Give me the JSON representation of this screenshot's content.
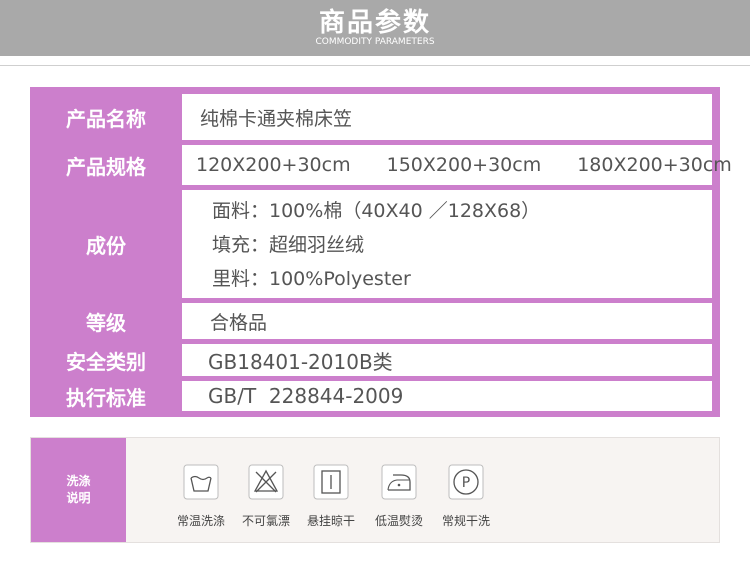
{
  "header": {
    "title": "商品参数",
    "subtitle": "COMMODITY PARAMETERS"
  },
  "params": {
    "name": {
      "label": "产品名称",
      "value": "纯棉卡通夹棉床笠"
    },
    "spec": {
      "label": "产品规格",
      "values": [
        "120X200+30cm",
        "150X200+30cm",
        "180X200+30cm"
      ]
    },
    "composition": {
      "label": "成份",
      "lines": [
        "面料：100%棉（40X40 ／128X68）",
        "填充：超细羽丝绒",
        "里料：100%Polyester"
      ]
    },
    "grade": {
      "label": "等级",
      "value": "合格品"
    },
    "safety": {
      "label": "安全类别",
      "value": "GB18401-2010B类"
    },
    "standard": {
      "label": "执行标准",
      "value": "GB/T  228844-2009"
    }
  },
  "care": {
    "label_line1": "洗涤",
    "label_line2": "说明",
    "items": [
      {
        "icon": "wash-tub-icon",
        "text": "常温洗涤"
      },
      {
        "icon": "no-bleach-icon",
        "text": "不可氯漂"
      },
      {
        "icon": "hang-dry-icon",
        "text": "悬挂晾干"
      },
      {
        "icon": "low-iron-icon",
        "text": "低温熨烫"
      },
      {
        "icon": "dry-clean-p-icon",
        "text": "常规干洗"
      }
    ]
  },
  "colors": {
    "accent": "#cc7fcc",
    "banner": "#a9a9a9"
  }
}
